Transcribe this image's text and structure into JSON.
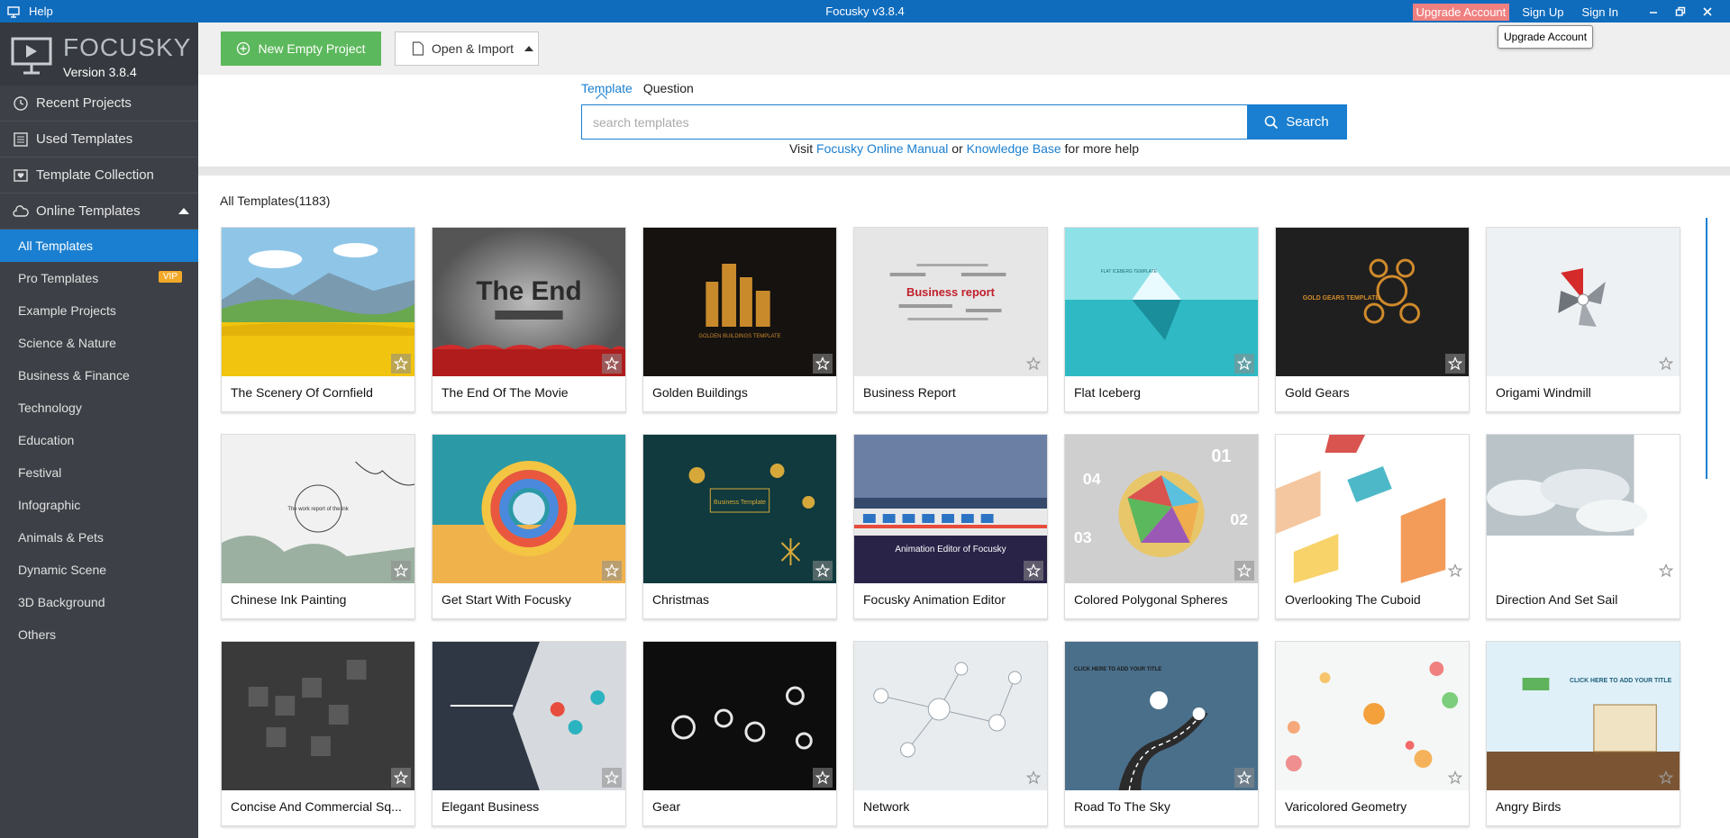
{
  "titlebar": {
    "help": "Help",
    "title": "Focusky v3.8.4",
    "upgrade": "Upgrade Account",
    "signup": "Sign Up",
    "signin": "Sign In",
    "accent": "#0f6cbd"
  },
  "tooltip": "Upgrade Account",
  "sidebar": {
    "brand": "FOCUSKY",
    "version": "Version 3.8.4",
    "main_items": [
      {
        "label": "Recent Projects",
        "icon": "clock-icon"
      },
      {
        "label": "Used Templates",
        "icon": "list-icon"
      },
      {
        "label": "Template Collection",
        "icon": "heart-icon"
      },
      {
        "label": "Online Templates",
        "icon": "cloud-icon"
      }
    ],
    "sub_items": [
      {
        "label": "All Templates"
      },
      {
        "label": "Pro Templates",
        "badge": "VIP"
      },
      {
        "label": "Example Projects"
      },
      {
        "label": "Science & Nature"
      },
      {
        "label": "Business & Finance"
      },
      {
        "label": "Technology"
      },
      {
        "label": "Education"
      },
      {
        "label": "Festival"
      },
      {
        "label": "Infographic"
      },
      {
        "label": "Animals & Pets"
      },
      {
        "label": "Dynamic Scene"
      },
      {
        "label": "3D Background"
      },
      {
        "label": "Others"
      }
    ]
  },
  "toolbar": {
    "new_project": "New Empty Project",
    "open_import": "Open & Import"
  },
  "search": {
    "tab_template": "Template",
    "tab_question": "Question",
    "placeholder": "search templates",
    "button": "Search",
    "help_visit": "Visit",
    "help_manual": "Focusky Online Manual",
    "help_or": "or",
    "help_kb": "Knowledge Base",
    "help_tail": "for more help"
  },
  "content": {
    "section_title": "All Templates(1183)",
    "templates": [
      {
        "name": "The Scenery Of Cornfield",
        "art": "cornfield"
      },
      {
        "name": "The End Of The Movie",
        "art": "movie",
        "thumb_text": "The End"
      },
      {
        "name": "Golden Buildings",
        "art": "buildings",
        "thumb_text": "GOLDEN BUILDINGS TEMPLATE"
      },
      {
        "name": "Business Report",
        "art": "report",
        "thumb_text": "Business report"
      },
      {
        "name": "Flat Iceberg",
        "art": "iceberg",
        "thumb_text": "FLAT ICEBERG TEMPLATE"
      },
      {
        "name": "Gold Gears",
        "art": "gears",
        "thumb_text": "GOLD GEARS TEMPLATE"
      },
      {
        "name": "Origami Windmill",
        "art": "windmill"
      },
      {
        "name": "Chinese Ink Painting",
        "art": "ink",
        "thumb_text": "The work report of the ink"
      },
      {
        "name": "Get Start With Focusky",
        "art": "focusky"
      },
      {
        "name": "Christmas",
        "art": "christmas",
        "thumb_text": "Business Template"
      },
      {
        "name": "Focusky Animation Editor",
        "art": "train",
        "thumb_text": "Animation Editor of Focusky"
      },
      {
        "name": "Colored Polygonal Spheres",
        "art": "sphere"
      },
      {
        "name": "Overlooking The Cuboid",
        "art": "cuboid"
      },
      {
        "name": "Direction And Set Sail",
        "art": "clouds"
      },
      {
        "name": "Concise And Commercial Sq...",
        "art": "squares"
      },
      {
        "name": "Elegant Business",
        "art": "elegant"
      },
      {
        "name": "Gear",
        "art": "gear"
      },
      {
        "name": "Network",
        "art": "network"
      },
      {
        "name": "Road To The Sky",
        "art": "road",
        "thumb_text": "CLICK HERE TO ADD YOUR TITLE"
      },
      {
        "name": "Varicolored Geometry",
        "art": "geometry"
      },
      {
        "name": "Angry Birds",
        "art": "birds",
        "thumb_text": "CLICK HERE TO ADD YOUR TITLE"
      }
    ]
  }
}
